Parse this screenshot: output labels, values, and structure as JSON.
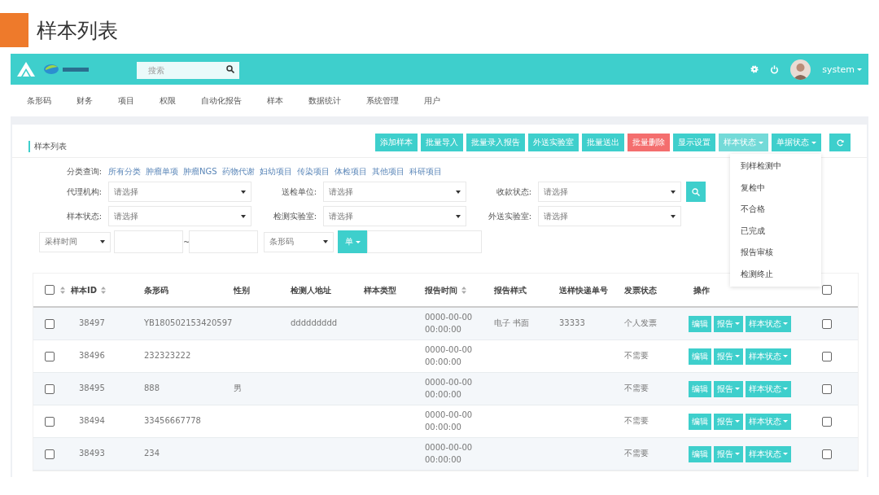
{
  "slide_title": "样本列表",
  "header": {
    "search": {
      "placeholder": "搜索"
    },
    "user": "system"
  },
  "nav": [
    "条形码",
    "财务",
    "项目",
    "权限",
    "自动化报告",
    "样本",
    "数据统计",
    "系统管理",
    "用户"
  ],
  "panel_title": "样本列表",
  "toolbar": [
    {
      "label": "添加样本",
      "kind": "primary",
      "dropdown": false,
      "open": false
    },
    {
      "label": "批量导入",
      "kind": "primary",
      "dropdown": false,
      "open": false
    },
    {
      "label": "批量录入报告",
      "kind": "primary",
      "dropdown": false,
      "open": false
    },
    {
      "label": "外送实验室",
      "kind": "primary",
      "dropdown": false,
      "open": false
    },
    {
      "label": "批量送出",
      "kind": "primary",
      "dropdown": false,
      "open": false
    },
    {
      "label": "批量删除",
      "kind": "danger",
      "dropdown": false,
      "open": false
    },
    {
      "label": "显示设置",
      "kind": "primary",
      "dropdown": false,
      "open": false
    },
    {
      "label": "样本状态",
      "kind": "primary",
      "dropdown": true,
      "open": true
    },
    {
      "label": "单据状态",
      "kind": "primary",
      "dropdown": true,
      "open": false
    }
  ],
  "dropdown_menu": [
    "到样检测中",
    "复检中",
    "不合格",
    "已完成",
    "报告审核",
    "检测终止"
  ],
  "category": {
    "label": "分类查询:",
    "links": [
      "所有分类",
      "肿瘤单项",
      "肿瘤NGS",
      "药物代谢",
      "妇幼项目",
      "传染项目",
      "体检项目",
      "其他项目",
      "科研项目"
    ]
  },
  "filter_rows": [
    [
      {
        "label": "代理机构:",
        "placeholder": "请选择"
      },
      {
        "label": "送检单位:",
        "placeholder": "请选择"
      },
      {
        "label": "收款状态:",
        "placeholder": "请选择"
      }
    ],
    [
      {
        "label": "样本状态:",
        "placeholder": "请选择"
      },
      {
        "label": "检测实验室:",
        "placeholder": "请选择"
      },
      {
        "label": "外送实验室:",
        "placeholder": "请选择"
      }
    ]
  ],
  "range_row": {
    "time_select": "采样时间",
    "separator": "~",
    "code_select": "条形码",
    "code_button": "单"
  },
  "table": {
    "header_checked": false,
    "header_checked_right": false,
    "columns": [
      {
        "label": "样本ID",
        "sortable": true
      },
      {
        "label": "条形码",
        "sortable": false
      },
      {
        "label": "性别",
        "sortable": false
      },
      {
        "label": "检测人地址",
        "sortable": false
      },
      {
        "label": "样本类型",
        "sortable": false
      },
      {
        "label": "报告时间",
        "sortable": true
      },
      {
        "label": "报告样式",
        "sortable": false
      },
      {
        "label": "送样快递单号",
        "sortable": false
      },
      {
        "label": "发票状态",
        "sortable": false
      },
      {
        "label": "操作",
        "sortable": false
      }
    ],
    "rows": [
      {
        "checked": false,
        "checked_right": false,
        "cells": [
          "38497",
          "YB180502153420597",
          "",
          "ddddddddd",
          "",
          "0000-00-00 00:00:00",
          "电子 书面",
          "33333",
          "个人发票"
        ],
        "actions": [
          "编辑",
          "报告",
          "样本状态"
        ]
      },
      {
        "checked": false,
        "checked_right": false,
        "cells": [
          "38496",
          "232323222",
          "",
          "",
          "",
          "0000-00-00 00:00:00",
          "",
          "",
          "不需要"
        ],
        "actions": [
          "编辑",
          "报告",
          "样本状态"
        ]
      },
      {
        "checked": false,
        "checked_right": false,
        "cells": [
          "38495",
          "888",
          "男",
          "",
          "",
          "0000-00-00 00:00:00",
          "",
          "",
          "不需要"
        ],
        "actions": [
          "编辑",
          "报告",
          "样本状态"
        ]
      },
      {
        "checked": false,
        "checked_right": false,
        "cells": [
          "38494",
          "33456667778",
          "",
          "",
          "",
          "0000-00-00 00:00:00",
          "",
          "",
          "不需要"
        ],
        "actions": [
          "编辑",
          "报告",
          "样本状态"
        ]
      },
      {
        "checked": false,
        "checked_right": false,
        "cells": [
          "38493",
          "234",
          "",
          "",
          "",
          "0000-00-00 00:00:00",
          "",
          "",
          "不需要"
        ],
        "actions": [
          "编辑",
          "报告",
          "样本状态"
        ]
      }
    ]
  }
}
